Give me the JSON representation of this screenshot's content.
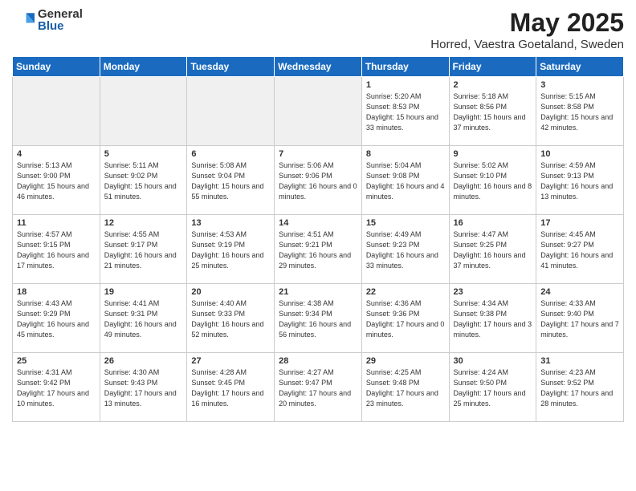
{
  "header": {
    "logo_general": "General",
    "logo_blue": "Blue",
    "month": "May 2025",
    "location": "Horred, Vaestra Goetaland, Sweden"
  },
  "weekdays": [
    "Sunday",
    "Monday",
    "Tuesday",
    "Wednesday",
    "Thursday",
    "Friday",
    "Saturday"
  ],
  "weeks": [
    [
      {
        "day": "",
        "empty": true
      },
      {
        "day": "",
        "empty": true
      },
      {
        "day": "",
        "empty": true
      },
      {
        "day": "",
        "empty": true
      },
      {
        "day": "1",
        "sunrise": "5:20 AM",
        "sunset": "8:53 PM",
        "daylight": "15 hours and 33 minutes."
      },
      {
        "day": "2",
        "sunrise": "5:18 AM",
        "sunset": "8:56 PM",
        "daylight": "15 hours and 37 minutes."
      },
      {
        "day": "3",
        "sunrise": "5:15 AM",
        "sunset": "8:58 PM",
        "daylight": "15 hours and 42 minutes."
      }
    ],
    [
      {
        "day": "4",
        "sunrise": "5:13 AM",
        "sunset": "9:00 PM",
        "daylight": "15 hours and 46 minutes."
      },
      {
        "day": "5",
        "sunrise": "5:11 AM",
        "sunset": "9:02 PM",
        "daylight": "15 hours and 51 minutes."
      },
      {
        "day": "6",
        "sunrise": "5:08 AM",
        "sunset": "9:04 PM",
        "daylight": "15 hours and 55 minutes."
      },
      {
        "day": "7",
        "sunrise": "5:06 AM",
        "sunset": "9:06 PM",
        "daylight": "16 hours and 0 minutes."
      },
      {
        "day": "8",
        "sunrise": "5:04 AM",
        "sunset": "9:08 PM",
        "daylight": "16 hours and 4 minutes."
      },
      {
        "day": "9",
        "sunrise": "5:02 AM",
        "sunset": "9:10 PM",
        "daylight": "16 hours and 8 minutes."
      },
      {
        "day": "10",
        "sunrise": "4:59 AM",
        "sunset": "9:13 PM",
        "daylight": "16 hours and 13 minutes."
      }
    ],
    [
      {
        "day": "11",
        "sunrise": "4:57 AM",
        "sunset": "9:15 PM",
        "daylight": "16 hours and 17 minutes."
      },
      {
        "day": "12",
        "sunrise": "4:55 AM",
        "sunset": "9:17 PM",
        "daylight": "16 hours and 21 minutes."
      },
      {
        "day": "13",
        "sunrise": "4:53 AM",
        "sunset": "9:19 PM",
        "daylight": "16 hours and 25 minutes."
      },
      {
        "day": "14",
        "sunrise": "4:51 AM",
        "sunset": "9:21 PM",
        "daylight": "16 hours and 29 minutes."
      },
      {
        "day": "15",
        "sunrise": "4:49 AM",
        "sunset": "9:23 PM",
        "daylight": "16 hours and 33 minutes."
      },
      {
        "day": "16",
        "sunrise": "4:47 AM",
        "sunset": "9:25 PM",
        "daylight": "16 hours and 37 minutes."
      },
      {
        "day": "17",
        "sunrise": "4:45 AM",
        "sunset": "9:27 PM",
        "daylight": "16 hours and 41 minutes."
      }
    ],
    [
      {
        "day": "18",
        "sunrise": "4:43 AM",
        "sunset": "9:29 PM",
        "daylight": "16 hours and 45 minutes."
      },
      {
        "day": "19",
        "sunrise": "4:41 AM",
        "sunset": "9:31 PM",
        "daylight": "16 hours and 49 minutes."
      },
      {
        "day": "20",
        "sunrise": "4:40 AM",
        "sunset": "9:33 PM",
        "daylight": "16 hours and 52 minutes."
      },
      {
        "day": "21",
        "sunrise": "4:38 AM",
        "sunset": "9:34 PM",
        "daylight": "16 hours and 56 minutes."
      },
      {
        "day": "22",
        "sunrise": "4:36 AM",
        "sunset": "9:36 PM",
        "daylight": "17 hours and 0 minutes."
      },
      {
        "day": "23",
        "sunrise": "4:34 AM",
        "sunset": "9:38 PM",
        "daylight": "17 hours and 3 minutes."
      },
      {
        "day": "24",
        "sunrise": "4:33 AM",
        "sunset": "9:40 PM",
        "daylight": "17 hours and 7 minutes."
      }
    ],
    [
      {
        "day": "25",
        "sunrise": "4:31 AM",
        "sunset": "9:42 PM",
        "daylight": "17 hours and 10 minutes."
      },
      {
        "day": "26",
        "sunrise": "4:30 AM",
        "sunset": "9:43 PM",
        "daylight": "17 hours and 13 minutes."
      },
      {
        "day": "27",
        "sunrise": "4:28 AM",
        "sunset": "9:45 PM",
        "daylight": "17 hours and 16 minutes."
      },
      {
        "day": "28",
        "sunrise": "4:27 AM",
        "sunset": "9:47 PM",
        "daylight": "17 hours and 20 minutes."
      },
      {
        "day": "29",
        "sunrise": "4:25 AM",
        "sunset": "9:48 PM",
        "daylight": "17 hours and 23 minutes."
      },
      {
        "day": "30",
        "sunrise": "4:24 AM",
        "sunset": "9:50 PM",
        "daylight": "17 hours and 25 minutes."
      },
      {
        "day": "31",
        "sunrise": "4:23 AM",
        "sunset": "9:52 PM",
        "daylight": "17 hours and 28 minutes."
      }
    ]
  ]
}
